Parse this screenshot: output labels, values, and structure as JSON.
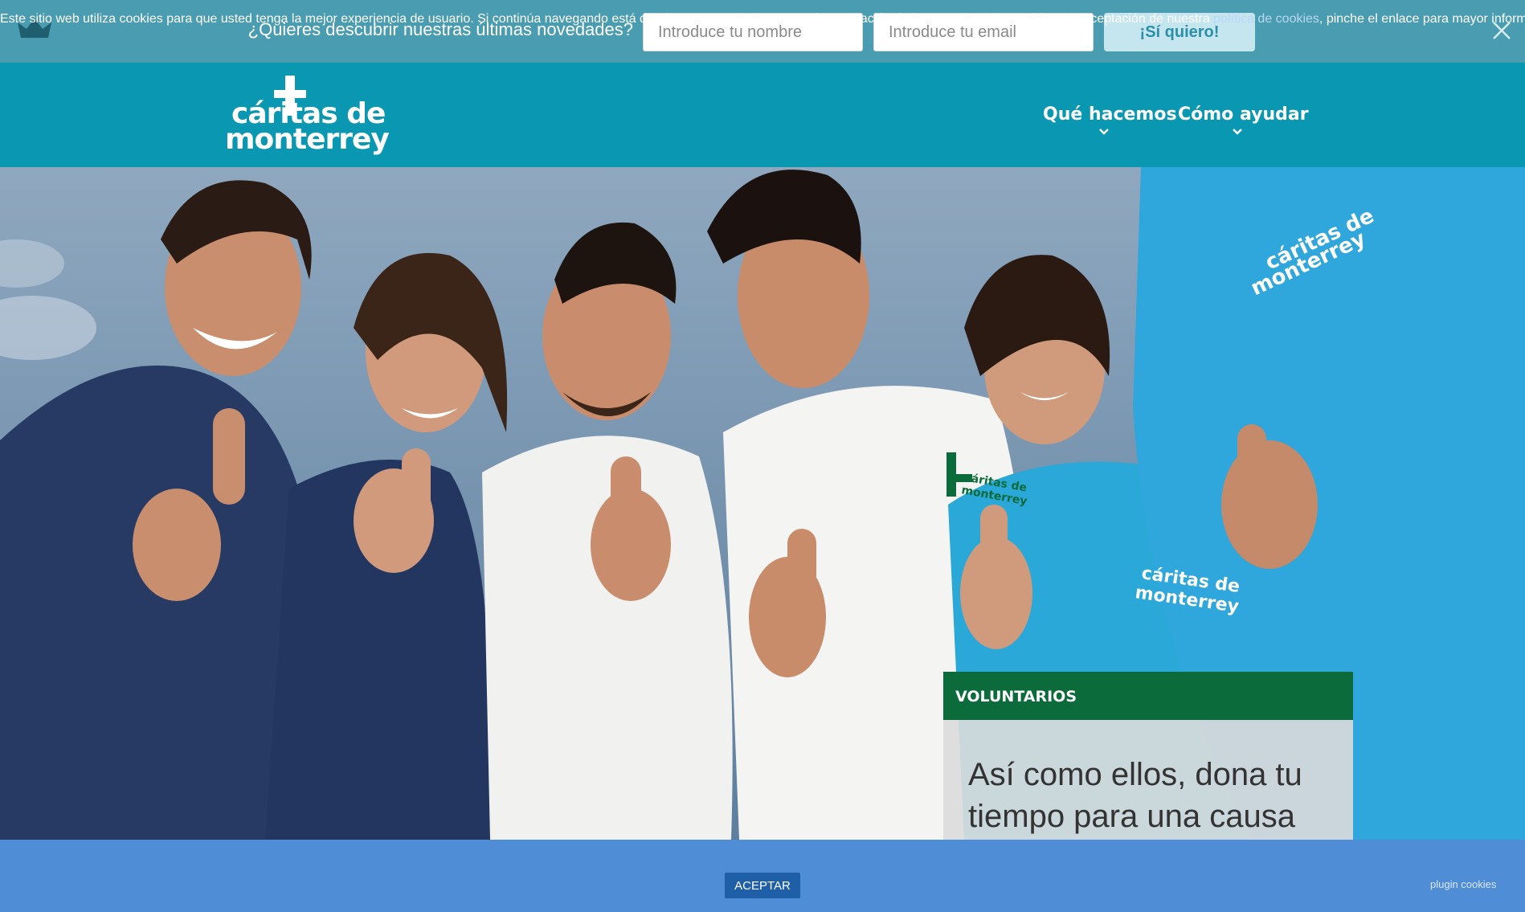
{
  "topbar": {
    "prompt": "¿Quieres descubrir nuestras últimas novedades?",
    "name_placeholder": "Introduce tu nombre",
    "email_placeholder": "Introduce tu email",
    "submit_label": "¡Sí quiero!",
    "icons": {
      "left": "crown-icon",
      "right": "close-icon"
    },
    "bg_color": "#4a9db0"
  },
  "header": {
    "logo_line1": "cáritas de",
    "logo_line2": "monterrey",
    "nav": [
      {
        "label": "Qué hacemos",
        "icon": "chevron-down-icon"
      },
      {
        "label": "Cómo ayudar",
        "icon": "chevron-down-icon"
      }
    ],
    "bg_color": "#0a97b1"
  },
  "hero": {
    "card": {
      "tag": "VOLUNTARIOS",
      "line1": "Así como ellos, dona tu",
      "line2": "tiempo para una causa"
    },
    "shirt_logo_line1": "cáritas de",
    "shirt_logo_line2": "monterrey"
  },
  "cookies": {
    "text_before": "Este sitio web utiliza cookies para que usted tenga la mejor experiencia de usuario. Si continúa navegando está dando su consentimiento para la aceptación de las mencionadas cookies y la aceptación de nuestra ",
    "link": "política de cookies",
    "text_after": ", pinche el enlace para mayor información.",
    "accept_label": "ACEPTAR",
    "plugin_label": "plugin cookies",
    "bg_color": "#4f8ed6"
  }
}
